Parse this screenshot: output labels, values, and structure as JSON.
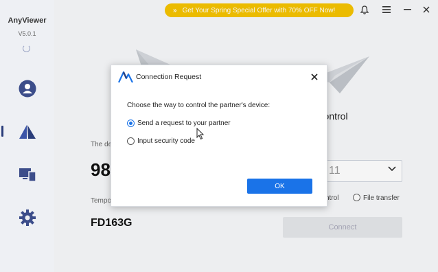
{
  "app": {
    "name": "AnyViewer",
    "version": "V5.0.1"
  },
  "sidebar": {
    "items": [
      {
        "icon": "user-icon"
      },
      {
        "icon": "remote-control-icon"
      },
      {
        "icon": "devices-icon"
      },
      {
        "icon": "gear-icon"
      }
    ]
  },
  "topbar": {
    "promo_text": "Get Your Spring Special Offer with 70% OFF Now!",
    "promo_arrows": "»",
    "promo_color": "#f5c300"
  },
  "left_panel": {
    "device_label_partial": "The de",
    "device_id_partial": "98",
    "temp_label_partial": "Tempo",
    "temp_code": "FD163G"
  },
  "right_panel": {
    "title_partial": "rt Control",
    "device_field_partial": "11",
    "option_control_partial": "ntrol",
    "option_file_transfer": "File transfer",
    "connect_label": "Connect"
  },
  "dialog": {
    "title": "Connection Request",
    "prompt": "Choose the way to control the partner's device:",
    "options": [
      {
        "label": "Send a request to your partner",
        "checked": true
      },
      {
        "label": "Input security code",
        "checked": false
      }
    ],
    "ok_label": "OK",
    "accent": "#1a73e8"
  }
}
